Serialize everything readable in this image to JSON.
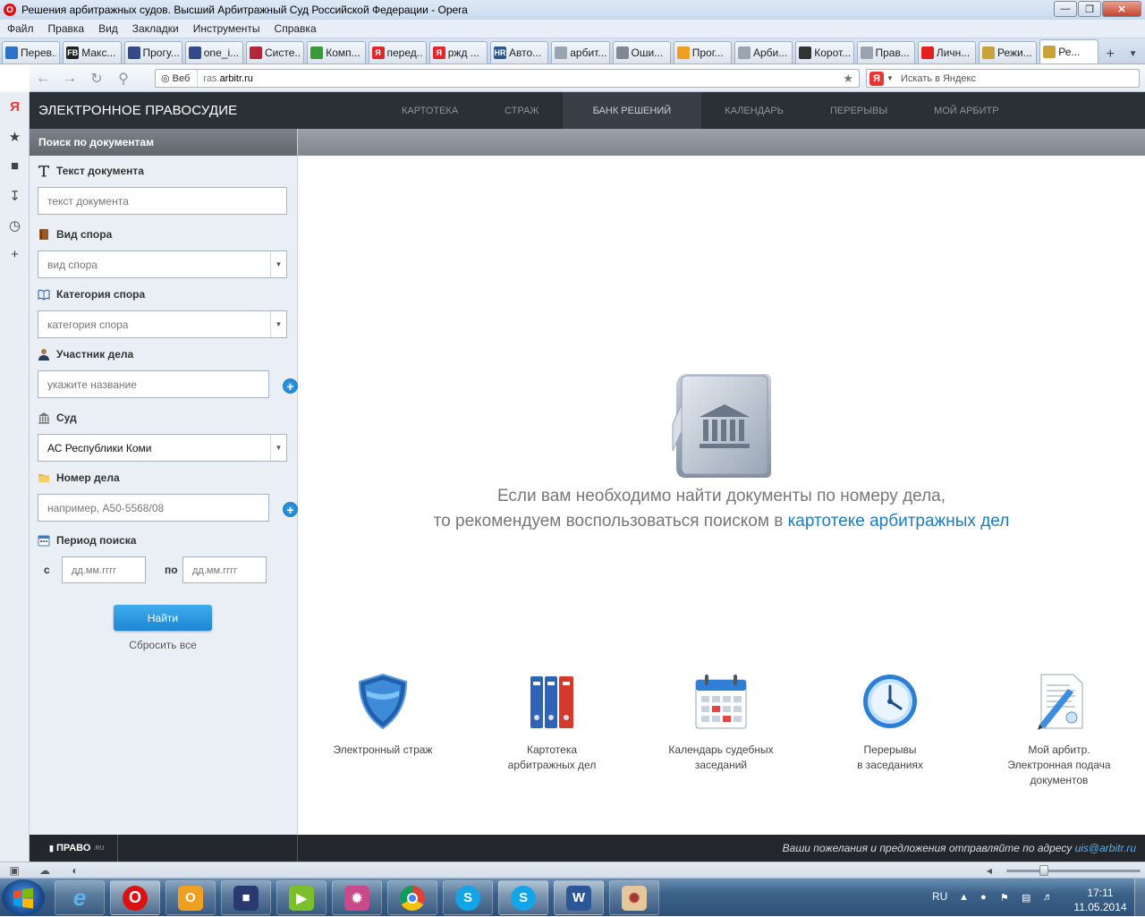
{
  "window": {
    "title": "Решения арбитражных судов. Высший Арбитражный Суд Российской Федерации - Opera"
  },
  "menu": [
    "Файл",
    "Правка",
    "Вид",
    "Закладки",
    "Инструменты",
    "Справка"
  ],
  "tabs": [
    {
      "label": "Перев...",
      "icon": "translate-icon",
      "color": "#2a73c9"
    },
    {
      "label": "Макс...",
      "icon": "fb-icon",
      "color": "#222222",
      "glyph": "FB"
    },
    {
      "label": "Прогу...",
      "icon": "user-icon",
      "color": "#334a8a"
    },
    {
      "label": "one_i...",
      "icon": "user-icon",
      "color": "#334a8a"
    },
    {
      "label": "Систе...",
      "icon": "system-icon",
      "color": "#b3263a"
    },
    {
      "label": "Комп...",
      "icon": "leaf-icon",
      "color": "#3a9a3a"
    },
    {
      "label": "перед...",
      "icon": "yandex-icon",
      "color": "#e3262a",
      "glyph": "Я"
    },
    {
      "label": "ржд ...",
      "icon": "yandex-icon",
      "color": "#e3262a",
      "glyph": "Я"
    },
    {
      "label": "Авто...",
      "icon": "hr-icon",
      "color": "#2c5a90",
      "glyph": "HR"
    },
    {
      "label": "арбит...",
      "icon": "page-icon",
      "color": "#9aa4b0"
    },
    {
      "label": "Оши...",
      "icon": "loading-icon",
      "color": "#7f8893"
    },
    {
      "label": "Прог...",
      "icon": "orange-icon",
      "color": "#f0a020"
    },
    {
      "label": "Арби...",
      "icon": "page-icon",
      "color": "#9aa4b0"
    },
    {
      "label": "Корот...",
      "icon": "dark-icon",
      "color": "#333333"
    },
    {
      "label": "Прав...",
      "icon": "page-icon",
      "color": "#9aa4b0"
    },
    {
      "label": "Личн...",
      "icon": "red-icon",
      "color": "#e52020"
    },
    {
      "label": "Режи...",
      "icon": "emblem-icon",
      "color": "#c9a23a"
    },
    {
      "label": "Ре...",
      "icon": "emblem-icon",
      "color": "#c9a23a",
      "active": true
    }
  ],
  "address": {
    "web_label": "Веб",
    "url_prefix": "ras.",
    "url_domain": "arbitr.ru",
    "search_placeholder": "Искать в Яндекс"
  },
  "site": {
    "brand": "ЭЛЕКТРОННОЕ ПРАВОСУДИЕ",
    "nav": [
      {
        "label": "КАРТОТЕКА"
      },
      {
        "label": "СТРАЖ"
      },
      {
        "label": "БАНК РЕШЕНИЙ",
        "active": true
      },
      {
        "label": "КАЛЕНДАРЬ"
      },
      {
        "label": "ПЕРЕРЫВЫ"
      },
      {
        "label": "МОЙ АРБИТР"
      }
    ]
  },
  "sidebar": {
    "title": "Поиск по документам",
    "fields": {
      "doc_text": {
        "label": "Текст документа",
        "placeholder": "текст документа"
      },
      "dispute_type": {
        "label": "Вид спора",
        "value": "вид спора"
      },
      "dispute_category": {
        "label": "Категория спора",
        "value": "категория спора"
      },
      "participant": {
        "label": "Участник дела",
        "placeholder": "укажите название"
      },
      "court": {
        "label": "Суд",
        "value": "АС Республики Коми"
      },
      "case_number": {
        "label": "Номер дела",
        "placeholder": "например, А50-5568/08"
      },
      "period": {
        "label": "Период поиска",
        "from_label": "с",
        "to_label": "по",
        "from_placeholder": "дд.мм.гггг",
        "to_placeholder": "дд.мм.гггг"
      }
    },
    "find_button": "Найти",
    "reset_link": "Сбросить все"
  },
  "main": {
    "hint_line1": "Если вам необходимо найти документы по номеру дела,",
    "hint_line2": "то рекомендуем воспользоваться поиском в",
    "hint_link": "картотеке арбитражных дел",
    "features": [
      {
        "lines": [
          "Электронный страж"
        ],
        "icon": "shield-icon"
      },
      {
        "lines": [
          "Картотека",
          "арбитражных дел"
        ],
        "icon": "binders-icon"
      },
      {
        "lines": [
          "Календарь судебных",
          "заседаний"
        ],
        "icon": "calendar-icon"
      },
      {
        "lines": [
          "Перерывы",
          "в заседаниях"
        ],
        "icon": "clock-icon"
      },
      {
        "lines": [
          "Мой арбитр.",
          "Электронная подача",
          "документов"
        ],
        "icon": "document-pen-icon"
      }
    ]
  },
  "footer": {
    "logo": "ПРАВО",
    "logo_sup": ".RU",
    "message": "Ваши пожелания и предложения отправляйте по адресу",
    "email": "uis@arbitr.ru"
  },
  "taskbar": {
    "lang": "RU",
    "time": "17:11",
    "date": "11.05.2014"
  }
}
